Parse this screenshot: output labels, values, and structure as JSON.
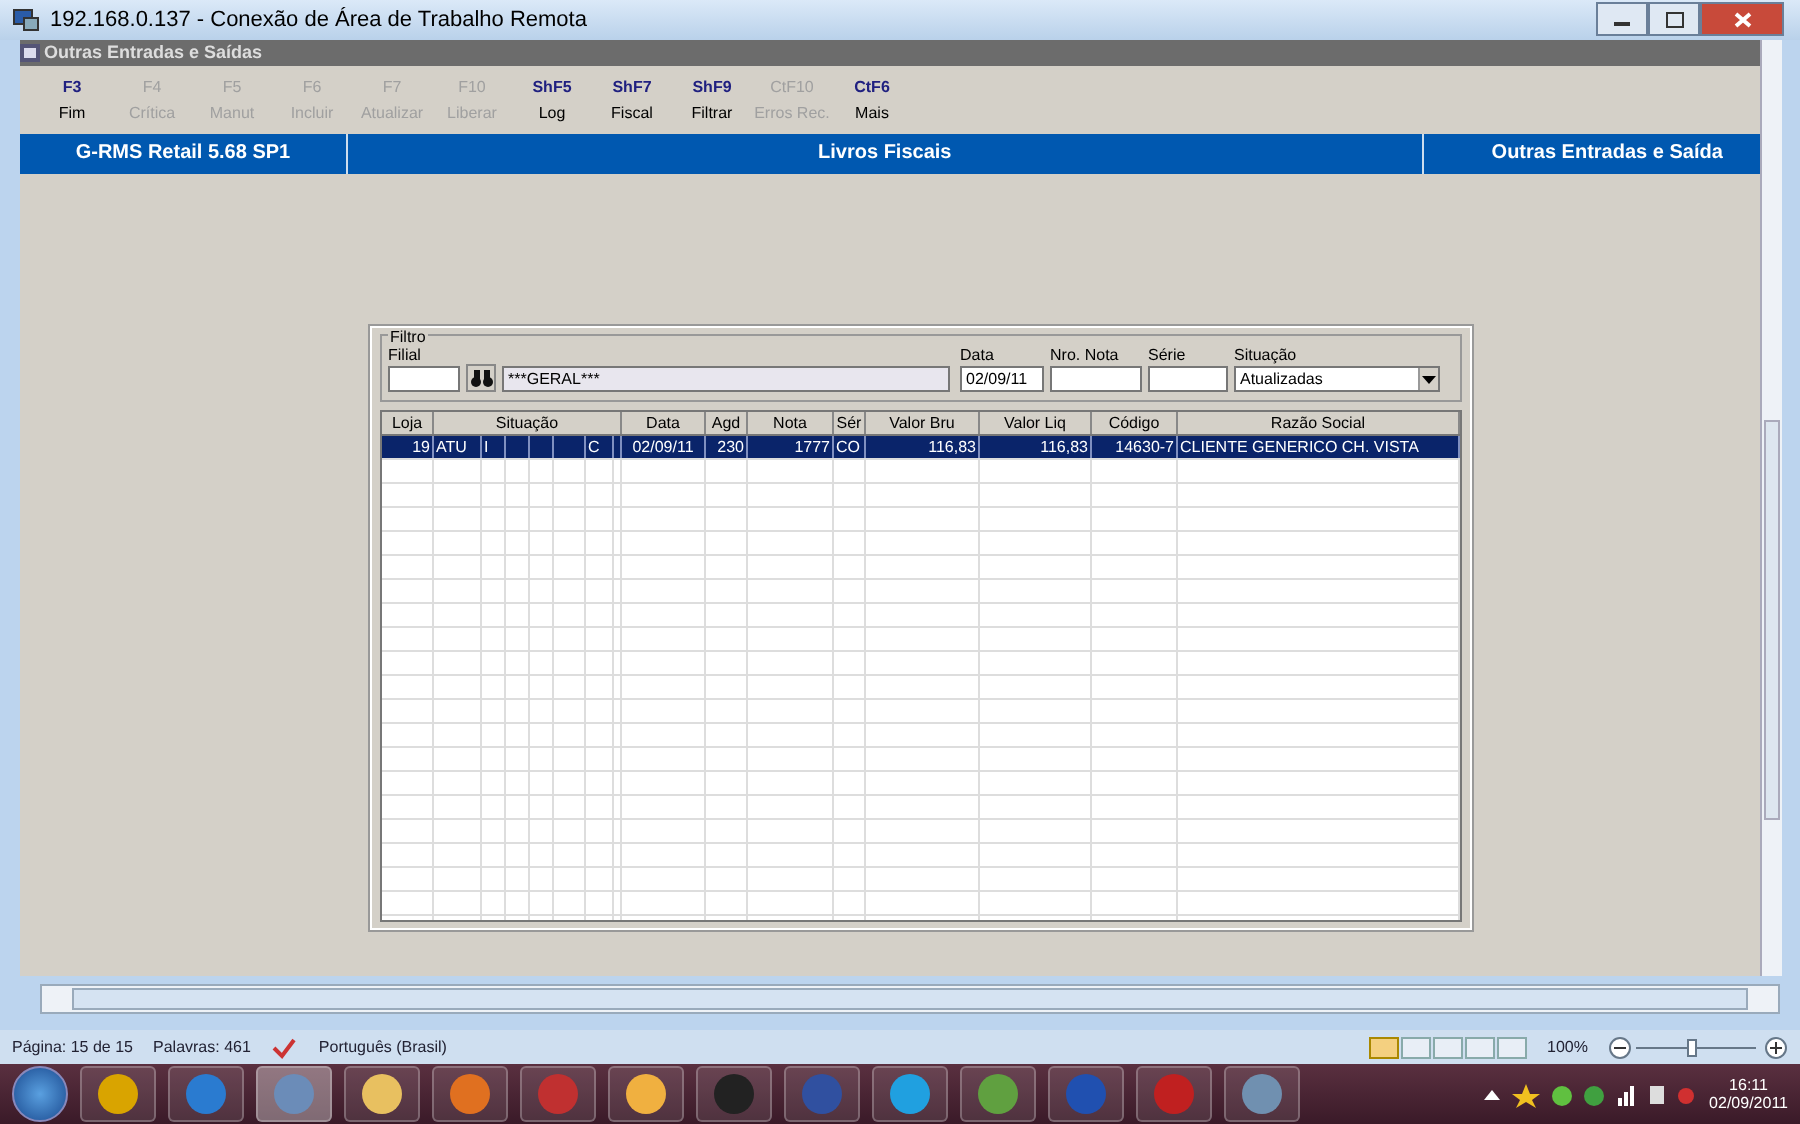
{
  "rdp_window": {
    "title": "192.168.0.137 - Conexão de Área de Trabalho Remota"
  },
  "app_window": {
    "title": "Outras Entradas e Saídas"
  },
  "toolbar": [
    {
      "key": "F3",
      "label": "Fim",
      "disabled": false
    },
    {
      "key": "F4",
      "label": "Crítica",
      "disabled": true
    },
    {
      "key": "F5",
      "label": "Manut",
      "disabled": true
    },
    {
      "key": "F6",
      "label": "Incluir",
      "disabled": true
    },
    {
      "key": "F7",
      "label": "Atualizar",
      "disabled": true
    },
    {
      "key": "F10",
      "label": "Liberar",
      "disabled": true
    },
    {
      "key": "ShF5",
      "label": "Log",
      "disabled": false
    },
    {
      "key": "ShF7",
      "label": "Fiscal",
      "disabled": false
    },
    {
      "key": "ShF9",
      "label": "Filtrar",
      "disabled": false
    },
    {
      "key": "CtF10",
      "label": "Erros Rec.",
      "disabled": true
    },
    {
      "key": "CtF6",
      "label": "Mais",
      "disabled": false
    }
  ],
  "header_bar": [
    "G-RMS Retail 5.68 SP1",
    "Livros Fiscais",
    "Outras Entradas e Saída"
  ],
  "filter": {
    "legend": "Filtro",
    "filial_label": "Filial",
    "filial_name": "***GERAL***",
    "data_label": "Data",
    "data_value": "02/09/11",
    "nota_label": "Nro. Nota",
    "serie_label": "Série",
    "situacao_label": "Situação",
    "situacao_value": "Atualizadas"
  },
  "table": {
    "columns": [
      "Loja",
      "Situação",
      "Data",
      "Agd",
      "Nota",
      "Sér",
      "Valor Bru",
      "Valor Liq",
      "Código",
      "Razão Social"
    ],
    "rows": [
      {
        "selected": true,
        "loja": "19",
        "situacao": [
          "ATU",
          "I",
          "C"
        ],
        "data": "02/09/11",
        "agd": "230",
        "nota": "1777",
        "serie": "CO",
        "valor_bru": "116,83",
        "valor_liq": "116,83",
        "codigo": "14630-7",
        "razao_social": "CLIENTE GENERICO CH. VISTA"
      }
    ]
  },
  "status_bar": {
    "page": "Página: 15 de 15",
    "words": "Palavras: 461",
    "language": "Português (Brasil)",
    "zoom": "100%"
  },
  "taskbar": {
    "time": "16:11",
    "date": "02/09/2011"
  }
}
